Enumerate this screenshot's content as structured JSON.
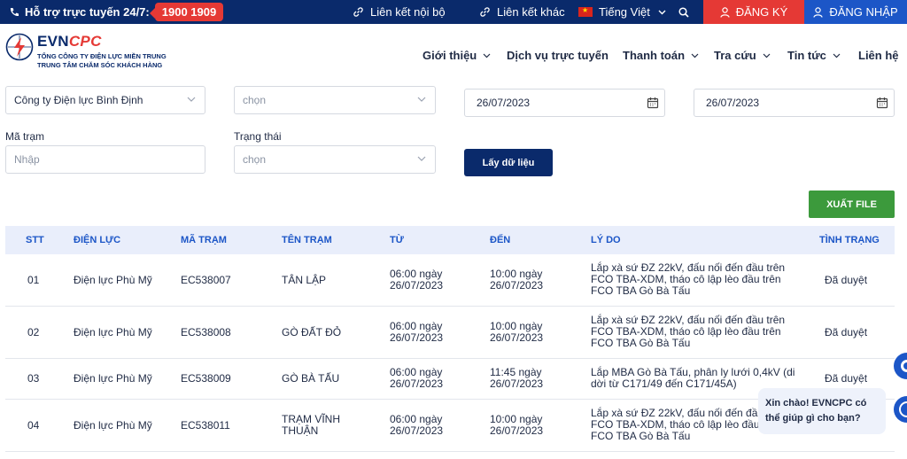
{
  "topbar": {
    "hotline_label": "Hỗ trợ trực tuyến 24/7:",
    "hotline_number": "1900 1909",
    "link_internal": "Liên kết nội bộ",
    "link_other": "Liên kết khác",
    "language": "Tiếng Việt",
    "register": "ĐĂNG KÝ",
    "login": "ĐĂNG NHẬP"
  },
  "header": {
    "brand_evn": "EVN",
    "brand_cpc": "CPC",
    "sub1": "TỔNG CÔNG TY ĐIỆN LỰC MIỀN TRUNG",
    "sub2": "TRUNG TÂM CHĂM SÓC KHÁCH HÀNG",
    "nav": [
      "Giới thiệu",
      "Dịch vụ trực tuyến",
      "Thanh toán",
      "Tra cứu",
      "Tin tức",
      "Liên hệ"
    ]
  },
  "filters": {
    "company_value": "Công ty Điện lực Bình Định",
    "unit_placeholder": "chọn",
    "from_date": "26/07/2023",
    "to_date": "26/07/2023",
    "station_label": "Mã trạm",
    "station_placeholder": "Nhập",
    "status_label": "Trạng thái",
    "status_placeholder": "chọn",
    "fetch_button": "Lấy dữ liệu",
    "export_button": "XUẤT FILE"
  },
  "table": {
    "headers": [
      "STT",
      "ĐIỆN LỰC",
      "MÃ TRẠM",
      "TÊN TRẠM",
      "TỪ",
      "ĐẾN",
      "LÝ DO",
      "TÌNH TRẠNG"
    ],
    "rows": [
      {
        "stt": "01",
        "dienluc": "Điện lực Phù Mỹ",
        "ma": "EC538007",
        "ten": "TÂN LẬP",
        "tu1": "06:00 ngày",
        "tu2": "26/07/2023",
        "den1": "10:00 ngày",
        "den2": "26/07/2023",
        "lydo1": "Lắp xà sứ ĐZ 22kV, đấu nối đến đầu trên",
        "lydo2": "FCO TBA-XDM, tháo cô lập lèo đầu trên",
        "lydo3": "FCO TBA Gò Bà Tấu",
        "status": "Đã duyệt"
      },
      {
        "stt": "02",
        "dienluc": "Điện lực Phù Mỹ",
        "ma": "EC538008",
        "ten": "GÒ ĐẤT ĐỎ",
        "tu1": "06:00 ngày",
        "tu2": "26/07/2023",
        "den1": "10:00 ngày",
        "den2": "26/07/2023",
        "lydo1": "Lắp xà sứ ĐZ 22kV, đấu nối đến đầu trên",
        "lydo2": "FCO TBA-XDM, tháo cô lập lèo đầu trên",
        "lydo3": "FCO TBA Gò Bà Tấu",
        "status": "Đã duyệt"
      },
      {
        "stt": "03",
        "dienluc": "Điện lực Phù Mỹ",
        "ma": "EC538009",
        "ten": "GÒ BÀ TẤU",
        "tu1": "06:00 ngày",
        "tu2": "26/07/2023",
        "den1": "11:45 ngày",
        "den2": "26/07/2023",
        "lydo1": "Lắp MBA Gò Bà Tấu, phân ly lưới 0,4kV (di",
        "lydo2": "dời từ C171/49 đến C171/45A)",
        "lydo3": "",
        "status": "Đã duyệt"
      },
      {
        "stt": "04",
        "dienluc": "Điện lực Phù Mỹ",
        "ma": "EC538011",
        "ten": "TRẠM VĨNH",
        "ten2": "THUẬN",
        "tu1": "06:00 ngày",
        "tu2": "26/07/2023",
        "den1": "10:00 ngày",
        "den2": "26/07/2023",
        "lydo1": "Lắp xà sứ ĐZ 22kV, đấu nối đến đầu t",
        "lydo2": "FCO TBA-XDM, tháo cô lập lèo đầu trê",
        "lydo3": "FCO TBA Gò Bà Tấu",
        "status": "Đã duyệt"
      }
    ]
  },
  "chat": {
    "line1": "Xin chào! EVNCPC có",
    "line2": "thể giúp gì cho bạn?"
  },
  "colors": {
    "navy": "#0a2a6b",
    "red": "#e53935",
    "blue": "#1c56c7",
    "green": "#3c9a3c"
  }
}
